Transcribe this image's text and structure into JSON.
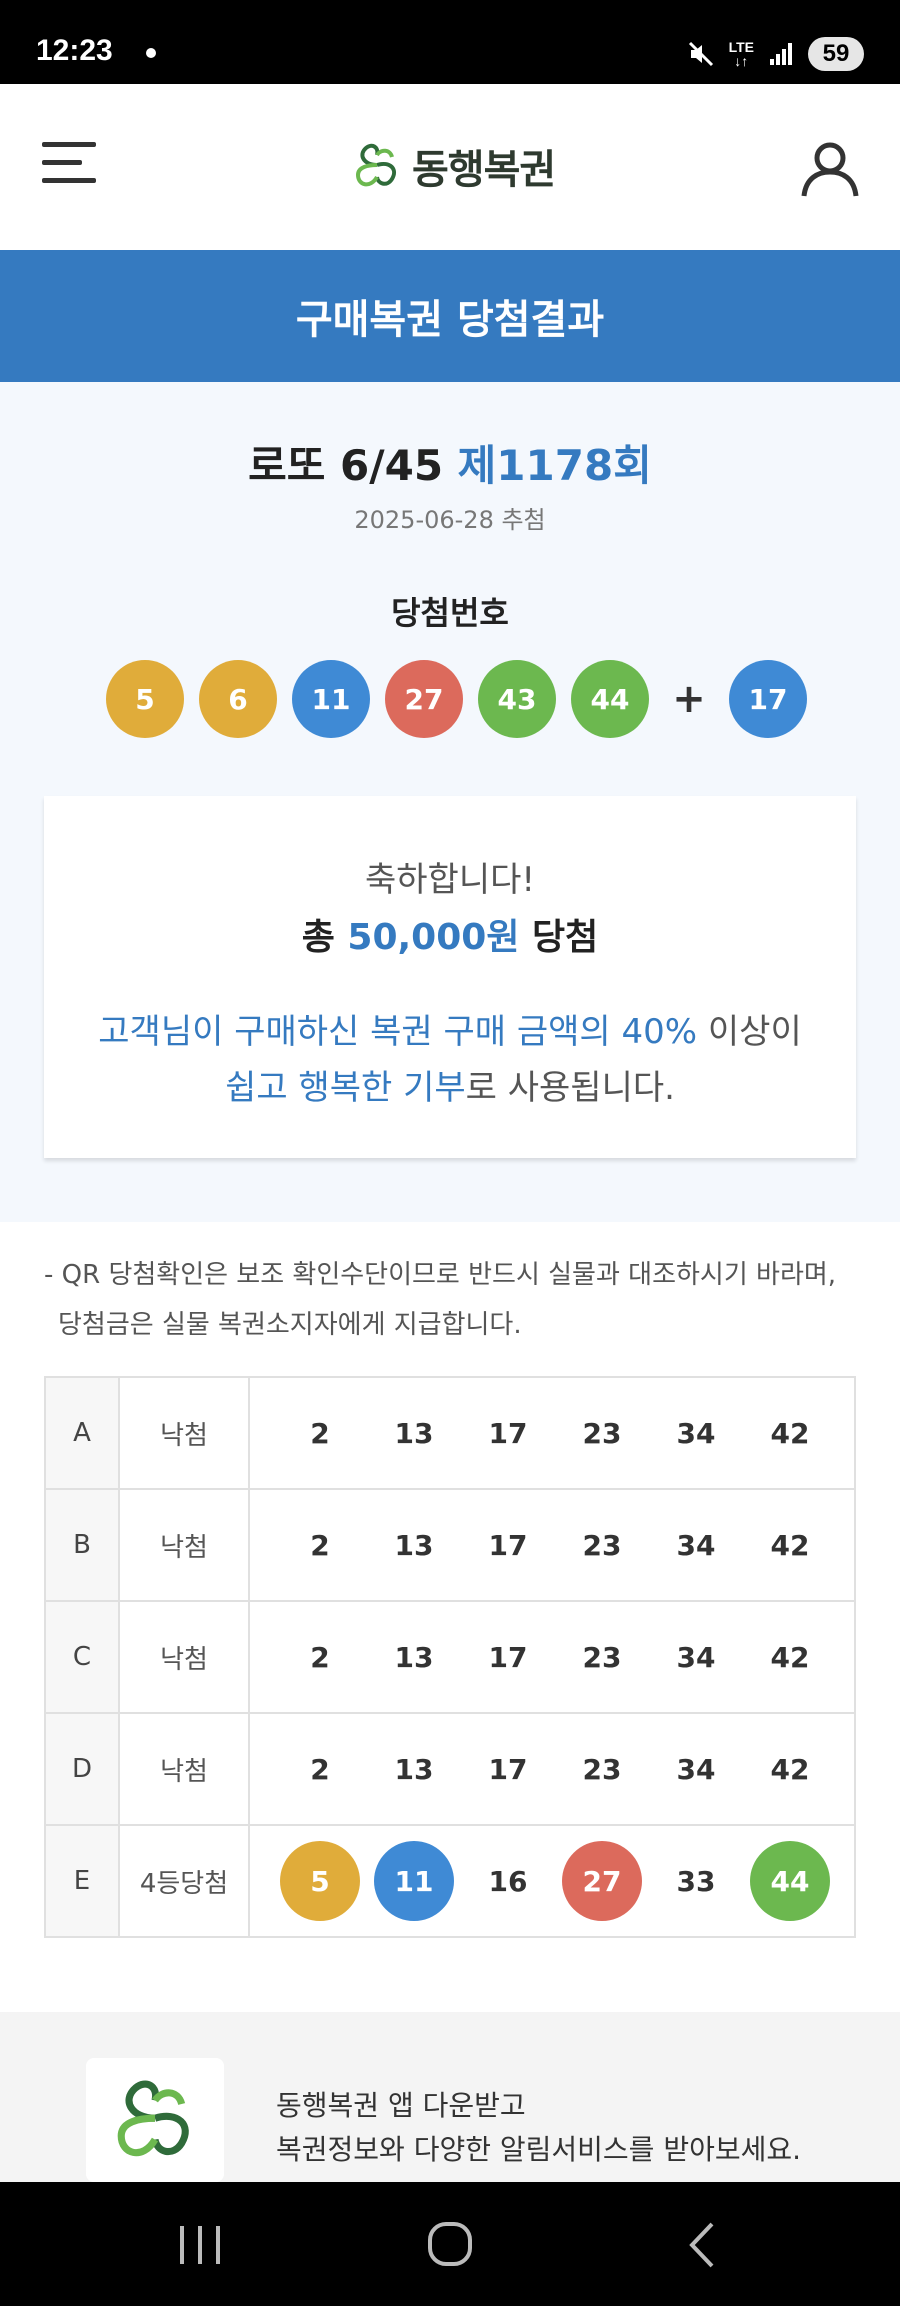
{
  "status_bar": {
    "time": "12:23",
    "network": "LTE",
    "battery": "59"
  },
  "header": {
    "logo_text": "동행복권",
    "brand_color": "#357ac0"
  },
  "banner": {
    "title": "구매복권 당첨결과"
  },
  "draw": {
    "game": "로또 6/45",
    "round": "제1178회",
    "date": "2025-06-28 추첨",
    "winning_label": "당첨번호",
    "numbers": [
      "5",
      "6",
      "11",
      "27",
      "43",
      "44"
    ],
    "plus": "+",
    "bonus": "17"
  },
  "congrats": {
    "line1": "축하합니다!",
    "total_prefix": "총",
    "total_amount": "50,000원",
    "total_suffix": "당첨",
    "donate_blue1": "고객님이 구매하신 복권 구매 금액의 40%",
    "donate_plain1": "이상이",
    "donate_blue2": "쉽고 행복한 기부",
    "donate_plain2": "로 사용됩니다."
  },
  "notice": {
    "line1": "- QR 당첨확인은 보조 확인수단이므로 반드시 실물과 대조하시기 바라며,",
    "line2": "당첨금은 실물 복권소지자에게 지급합니다."
  },
  "tickets": [
    {
      "letter": "A",
      "status": "낙첨",
      "numbers": [
        "2",
        "13",
        "17",
        "23",
        "34",
        "42"
      ]
    },
    {
      "letter": "B",
      "status": "낙첨",
      "numbers": [
        "2",
        "13",
        "17",
        "23",
        "34",
        "42"
      ]
    },
    {
      "letter": "C",
      "status": "낙첨",
      "numbers": [
        "2",
        "13",
        "17",
        "23",
        "34",
        "42"
      ]
    },
    {
      "letter": "D",
      "status": "낙첨",
      "numbers": [
        "2",
        "13",
        "17",
        "23",
        "34",
        "42"
      ]
    },
    {
      "letter": "E",
      "status": "4등당첨",
      "numbers": [
        "5",
        "11",
        "16",
        "27",
        "33",
        "44"
      ]
    }
  ],
  "promo": {
    "line1": "동행복권 앱 다운받고",
    "line2": "복권정보와 다양한 알림서비스를 받아보세요."
  }
}
